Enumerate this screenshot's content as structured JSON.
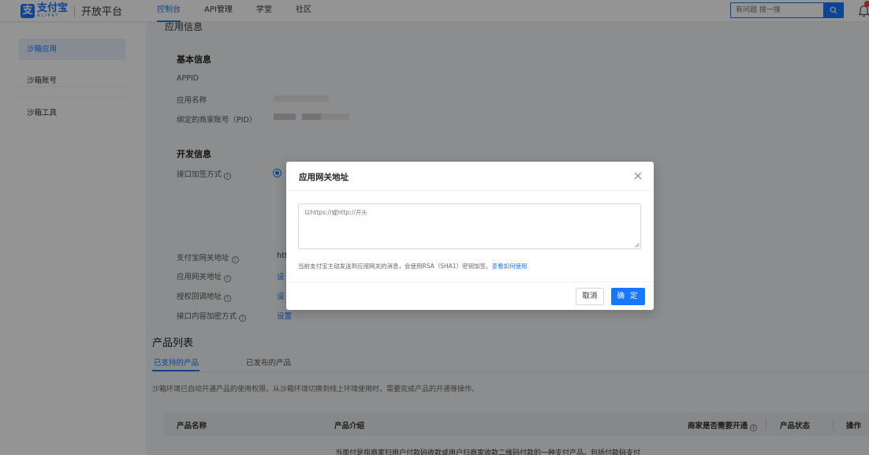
{
  "header": {
    "logo_cn": "支付宝",
    "logo_en": "ALIPAY",
    "platform": "开放平台",
    "nav": [
      {
        "label": "控制台",
        "active": true
      },
      {
        "label": "API管理"
      },
      {
        "label": "学堂"
      },
      {
        "label": "社区"
      }
    ],
    "search_placeholder": "有问题 搜一搜"
  },
  "sidebar": {
    "items": [
      {
        "label": "沙箱应用",
        "active": true
      },
      {
        "label": "沙箱账号"
      },
      {
        "label": "沙箱工具"
      }
    ]
  },
  "main": {
    "cut_title": "应用信息",
    "basic": {
      "title": "基本信息",
      "appid_label": "APPID",
      "appname_label": "应用名称",
      "pid_label": "绑定的商家账号（PID）"
    },
    "dev": {
      "title": "开发信息",
      "sign_label": "接口加签方式",
      "gateway_label": "支付宝网关地址",
      "gateway_value": "htt",
      "app_gateway_label": "应用网关地址",
      "app_gateway_value": "设",
      "auth_label": "授权回调地址",
      "auth_value": "设",
      "encrypt_label": "接口内容加密方式",
      "encrypt_value": "设置"
    },
    "products": {
      "title": "产品列表",
      "tabs": [
        "已支持的产品",
        "已发布的产品"
      ],
      "note": "沙箱环境已自动开通产品的使用权限，从沙箱环境切换到线上环境使用时，需要完成产品的开通等操作。",
      "columns": [
        "产品名称",
        "产品介绍",
        "商家是否需要开通",
        "产品状态",
        "操作"
      ],
      "row_text": "当面付是指商家扫用户付款码收款或用户扫商家收款二维码付款的一种支付产品。包括付款码支付"
    }
  },
  "dialog": {
    "title": "应用网关地址",
    "placeholder": "以https://或http://开头",
    "help": "当前支付宝主动发送到应用网关的消息，会使用RSA（SHA1）密钥加签。",
    "help_link": "查看如何使用",
    "cancel": "取消",
    "ok": "确 定"
  },
  "colors": {
    "primary": "#1677ff"
  }
}
